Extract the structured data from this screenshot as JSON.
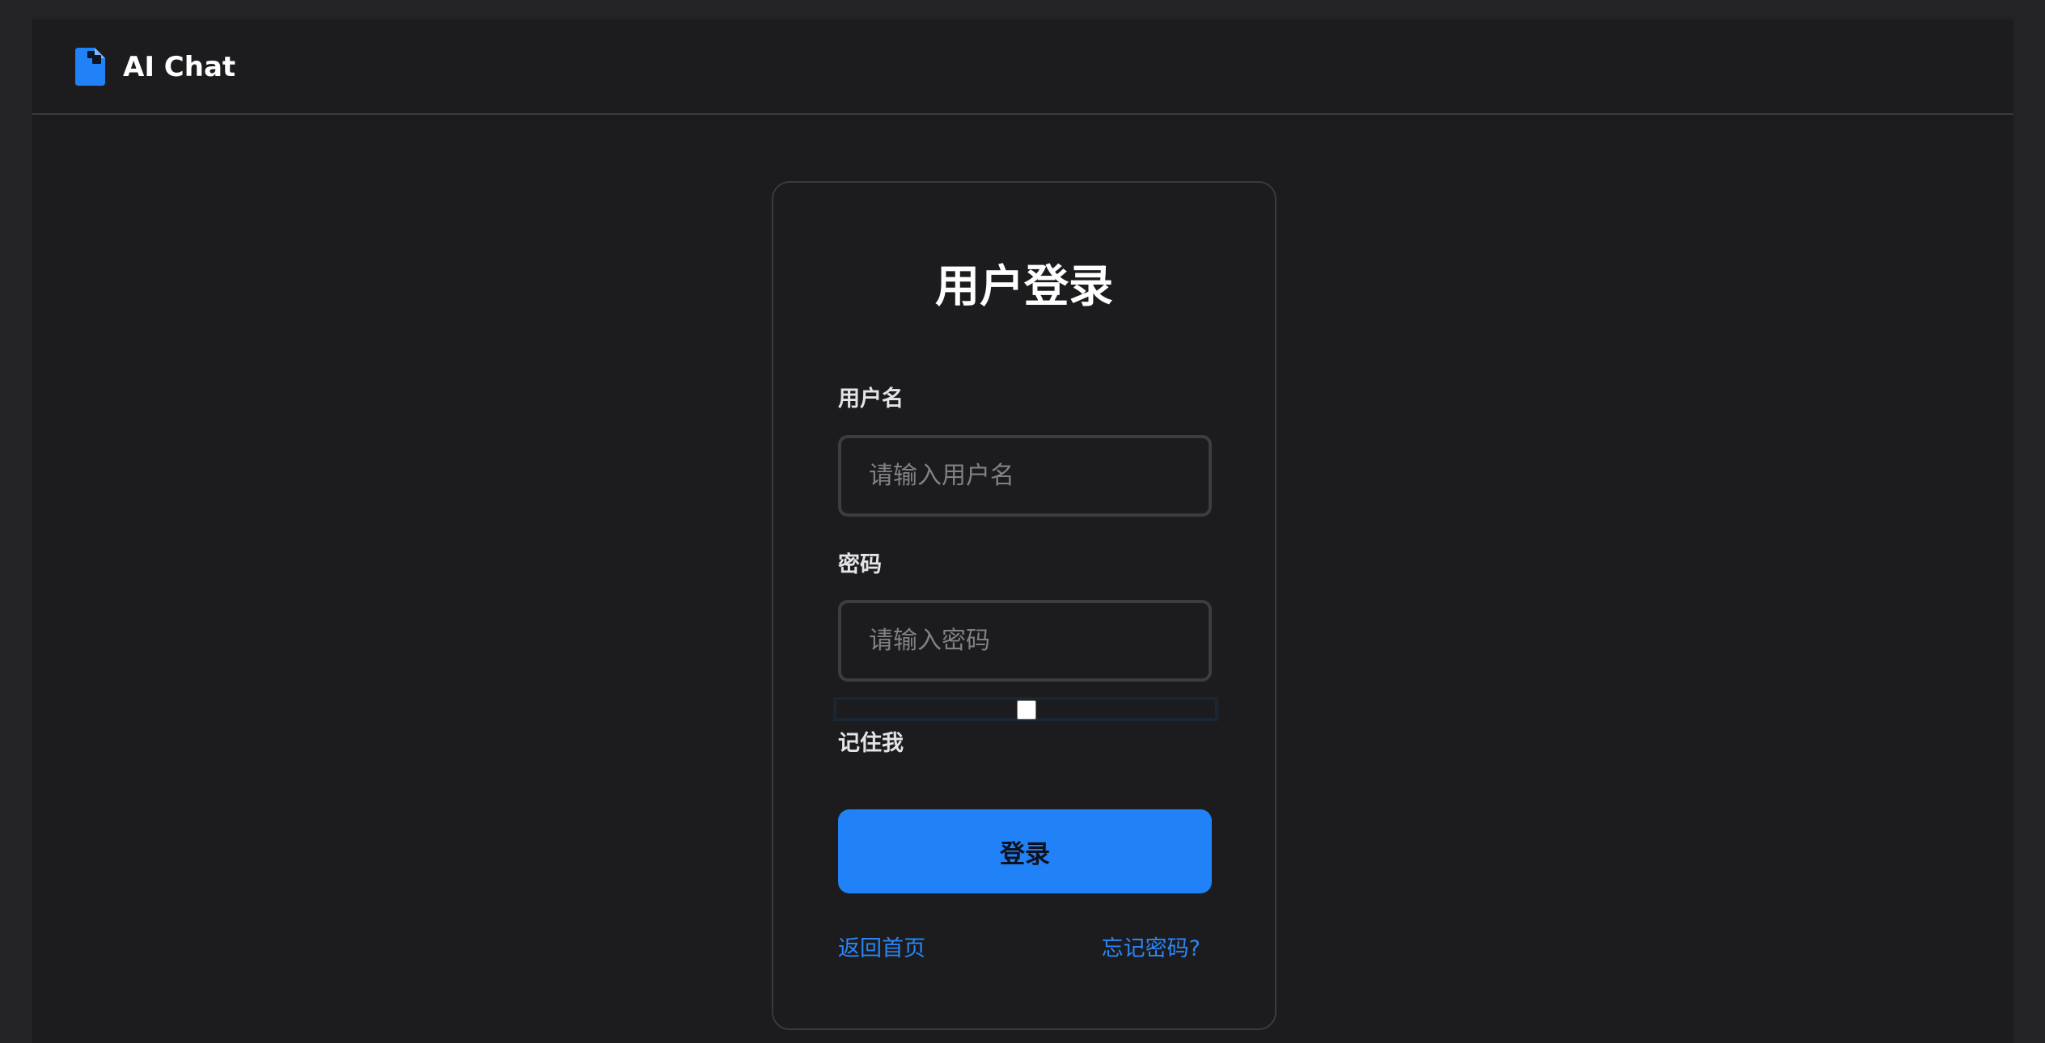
{
  "header": {
    "brand_icon": "document-icon",
    "title": "AI Chat"
  },
  "login": {
    "title": "用户登录",
    "username_label": "用户名",
    "username_placeholder": "请输入用户名",
    "username_value": "",
    "password_label": "密码",
    "password_placeholder": "请输入密码",
    "password_value": "",
    "remember_label": "记住我",
    "remember_checked": false,
    "submit_label": "登录",
    "back_home_link": "返回首页",
    "forgot_password_link": "忘记密码?"
  },
  "colors": {
    "background": "#1c1c1e",
    "accent": "#2181f6",
    "link": "#2a86f7",
    "border": "#3a3a3d"
  }
}
